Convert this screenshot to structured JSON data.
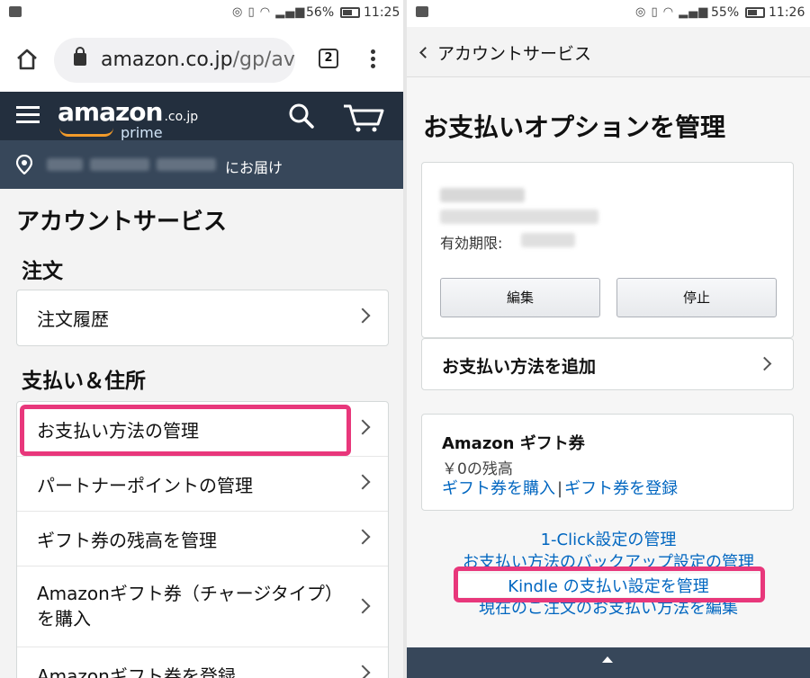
{
  "left": {
    "status": {
      "percent": "56%",
      "time": "11:25"
    },
    "browser": {
      "url_host": "amazon.co.jp",
      "url_path": "/gp/av",
      "tab_count": "2"
    },
    "header": {
      "logo_word": "amazon",
      "logo_domain": ".co.jp",
      "logo_prime": "prime"
    },
    "deliver": {
      "suffix": "にお届け"
    },
    "page_title": "アカウントサービス",
    "sections": {
      "orders": {
        "heading": "注文",
        "items": [
          {
            "label": "注文履歴"
          }
        ]
      },
      "payments": {
        "heading": "支払い＆住所",
        "items": [
          {
            "label": "お支払い方法の管理"
          },
          {
            "label": "パートナーポイントの管理"
          },
          {
            "label": "ギフト券の残高を管理"
          },
          {
            "label": "Amazonギフト券（チャージタイプ）を購入"
          },
          {
            "label": "Amazonギフト券を登録"
          }
        ]
      }
    }
  },
  "right": {
    "status": {
      "percent": "55%",
      "time": "11:26"
    },
    "nav": {
      "back_label": "アカウントサービス"
    },
    "title": "お支払いオプションを管理",
    "card": {
      "expiry_label": "有効期限:",
      "edit_button": "編集",
      "stop_button": "停止"
    },
    "add_payment": "お支払い方法を追加",
    "gift": {
      "title": "Amazon ギフト券",
      "balance": "￥0の残高",
      "buy_link": "ギフト券を購入",
      "separator": "|",
      "register_link": "ギフト券を登録"
    },
    "links": {
      "one_click": "1-Click設定の管理",
      "backup": "お支払い方法のバックアップ設定の管理",
      "kindle": "Kindle の支払い設定を管理",
      "current_order": "現在のご注文のお支払い方法を編集"
    }
  },
  "colors": {
    "highlight": "#e8377b",
    "amazon_dark": "#232f3e",
    "amazon_mid": "#37475a",
    "link": "#0066c0",
    "smile": "#f29b2a"
  }
}
